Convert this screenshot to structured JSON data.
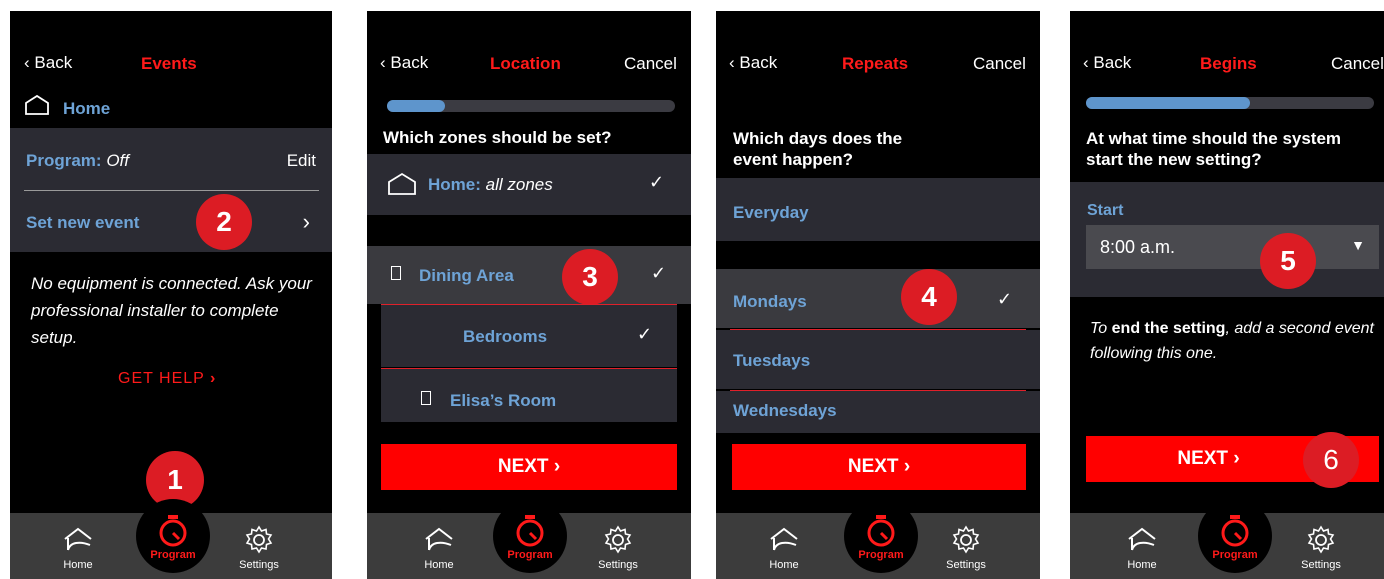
{
  "screen1": {
    "back": "Back",
    "title": "Events",
    "home_label": "Home",
    "program_label": "Program:",
    "program_value": "Off",
    "edit_label": "Edit",
    "set_event_label": "Set new event",
    "message": "No equipment is connected. Ask your professional installer to complete setup.",
    "get_help": "GET HELP",
    "badge_2": "2",
    "badge_1": "1"
  },
  "screen2": {
    "back": "Back",
    "title": "Location",
    "cancel": "Cancel",
    "progress": 0.2,
    "question": "Which zones should be set?",
    "home_zone_label": "Home:",
    "home_zone_value": "all zones",
    "zones": [
      "Dining Area",
      "Bedrooms",
      "Elisa’s Room"
    ],
    "next": "NEXT",
    "badge_3": "3"
  },
  "screen3": {
    "back": "Back",
    "title": "Repeats",
    "cancel": "Cancel",
    "question": "Which days does the event happen?",
    "days": [
      "Everyday",
      "Mondays",
      "Tuesdays",
      "Wednesdays"
    ],
    "next": "NEXT",
    "badge_4": "4"
  },
  "screen4": {
    "back": "Back",
    "title": "Begins",
    "cancel": "Cancel",
    "progress": 0.57,
    "question": "At what time should the system start the new setting?",
    "start_label": "Start",
    "start_value": "8:00 a.m.",
    "note_prefix": "To",
    "note_bold": "end the setting",
    "note_suffix": ", add a second event following this one.",
    "next": "NEXT",
    "badge_5": "5",
    "badge_6": "6"
  },
  "nav": {
    "home": "Home",
    "program": "Program",
    "settings": "Settings"
  },
  "colors": {
    "accent_red": "#ff0000",
    "badge_red": "#dc1c24",
    "label_blue": "#6ea3d6",
    "row_gray": "#2b2b33",
    "nav_gray": "#3c3c3c"
  }
}
